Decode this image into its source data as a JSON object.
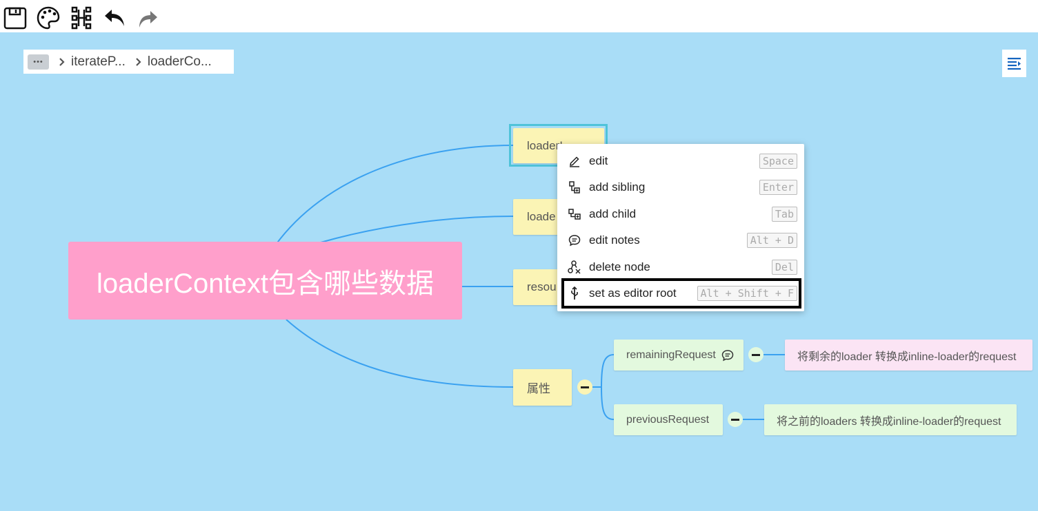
{
  "toolbar": {
    "icons": [
      "save-icon",
      "palette-icon",
      "layout-icon",
      "undo-icon",
      "redo-icon"
    ]
  },
  "breadcrumb": {
    "more": "•••",
    "items": [
      "iterateP...",
      "loaderCo..."
    ]
  },
  "mindmap": {
    "root": "loaderContext包含哪些数据",
    "children": [
      {
        "label": "loaderI..."
      },
      {
        "label": "loade"
      },
      {
        "label": "resou"
      },
      {
        "label": "属性"
      }
    ],
    "attr_children": [
      {
        "label": "remainingRequest",
        "note": "将剩余的loader 转换成inline-loader的request"
      },
      {
        "label": "previousRequest",
        "note": "将之前的loaders 转换成inline-loader的request"
      }
    ]
  },
  "context_menu": {
    "items": [
      {
        "icon": "edit-icon",
        "label": "edit",
        "shortcut": "Space"
      },
      {
        "icon": "add-sibling-icon",
        "label": "add sibling",
        "shortcut": "Enter"
      },
      {
        "icon": "add-child-icon",
        "label": "add child",
        "shortcut": "Tab"
      },
      {
        "icon": "notes-icon",
        "label": "edit notes",
        "shortcut": "Alt + D"
      },
      {
        "icon": "delete-node-icon",
        "label": "delete node",
        "shortcut": "Del"
      },
      {
        "icon": "set-root-icon",
        "label": "set as editor root",
        "shortcut": "Alt + Shift + F"
      }
    ]
  },
  "colors": {
    "canvas": "#a9ddf7",
    "root": "#ff9fcb",
    "topic": "#fbf4b5",
    "subtopic": "#e3f9de",
    "note": "#fbe4f4",
    "line": "#3aa1f0",
    "selection": "#4fc3d9"
  }
}
